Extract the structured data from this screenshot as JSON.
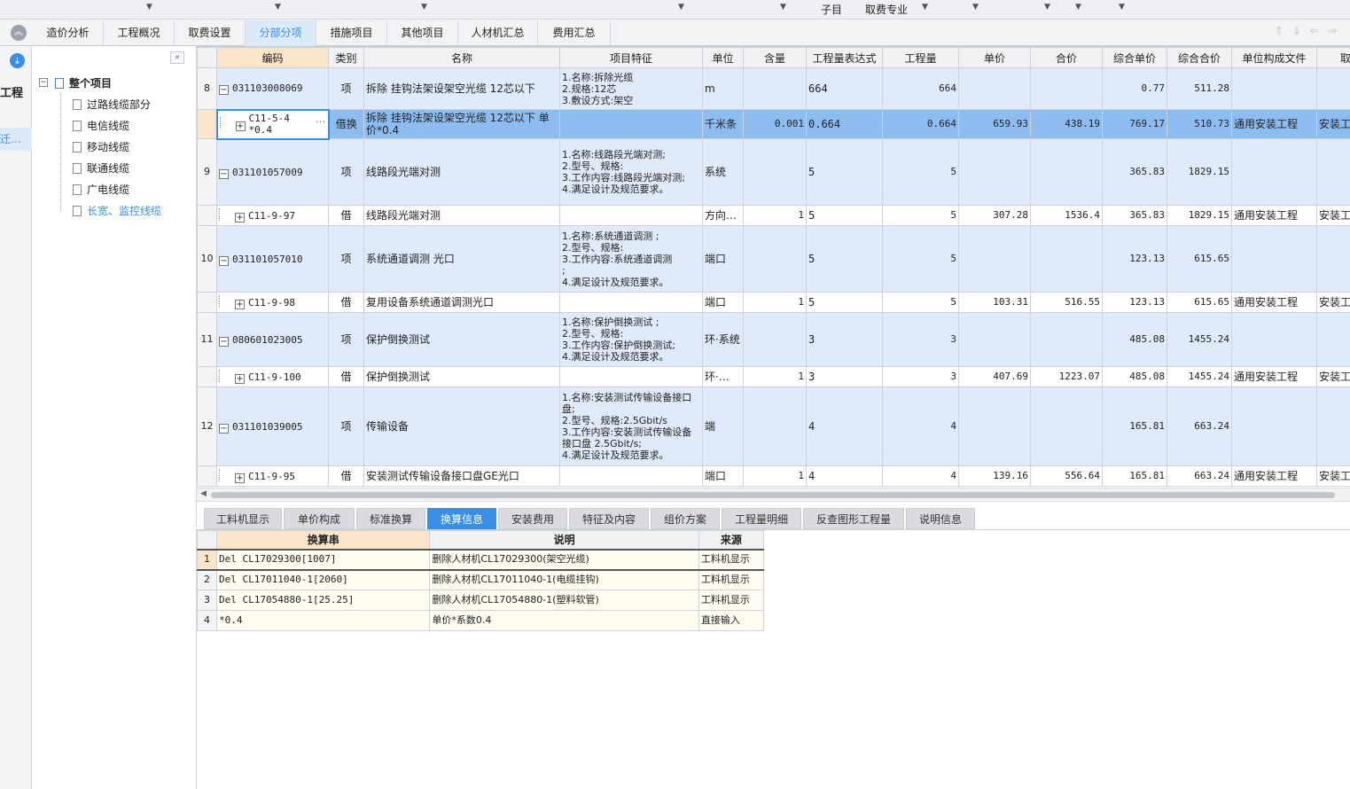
{
  "topbar": {
    "labels": [
      "子目",
      "取费专业"
    ]
  },
  "main_tabs": [
    {
      "label": "造价分析"
    },
    {
      "label": "工程概况"
    },
    {
      "label": "取费设置"
    },
    {
      "label": "分部分项"
    },
    {
      "label": "措施项目"
    },
    {
      "label": "其他项目"
    },
    {
      "label": "人材机汇总"
    },
    {
      "label": "费用汇总"
    }
  ],
  "active_main_tab": "分部分项",
  "rail": {
    "title": "工程",
    "selected": "迁..."
  },
  "tree": {
    "root": "整个项目",
    "children": [
      "过路线缆部分",
      "电信线缆",
      "移动线缆",
      "联通线缆",
      "广电线缆",
      "长宽、监控线缆"
    ],
    "selected": "长宽、监控线缆"
  },
  "grid": {
    "headers": [
      "编码",
      "类别",
      "名称",
      "项目特征",
      "单位",
      "含量",
      "工程量表达式",
      "工程量",
      "单价",
      "合价",
      "综合单价",
      "综合合价",
      "单位构成文件",
      "取费"
    ],
    "rows": [
      {
        "kind": "item",
        "rn": "8",
        "code": "031103008069",
        "type": "项",
        "name": "拆除 挂钩法架设架空光缆 12芯以下",
        "feature": "1.名称:拆除光缆\n2.规格:12芯\n3.敷设方式:架空",
        "unit": "m",
        "content": "",
        "expr": "664",
        "qty": "664",
        "price": "",
        "total": "",
        "cprice": "0.77",
        "ctotal": "511.28",
        "file": "",
        "fee": ""
      },
      {
        "kind": "sel",
        "rn": "",
        "code": "C11-5-4\n*0.4",
        "type": "借换",
        "name": "拆除 挂钩法架设架空光缆 12芯以下 单价*0.4",
        "feature": "",
        "unit": "千米条",
        "content": "0.001",
        "expr": "0.664",
        "qty": "0.664",
        "price": "659.93",
        "total": "438.19",
        "cprice": "769.17",
        "ctotal": "510.73",
        "file": "通用安装工程",
        "fee": "安装工"
      },
      {
        "kind": "item",
        "rn": "9",
        "code": "031101057009",
        "type": "项",
        "name": "线路段光端对测",
        "feature": "1.名称:线路段光端对测;\n2.型号、规格:\n3.工作内容:线路段光端对测;\n4.满足设计及规范要求。",
        "unit": "系统",
        "content": "",
        "expr": "5",
        "qty": "5",
        "price": "",
        "total": "",
        "cprice": "365.83",
        "ctotal": "1829.15",
        "file": "",
        "fee": ""
      },
      {
        "kind": "sub",
        "rn": "",
        "code": "C11-9-97",
        "type": "借",
        "name": "线路段光端对测",
        "feature": "",
        "unit": "方向…",
        "content": "1",
        "expr": "5",
        "qty": "5",
        "price": "307.28",
        "total": "1536.4",
        "cprice": "365.83",
        "ctotal": "1829.15",
        "file": "通用安装工程",
        "fee": "安装工"
      },
      {
        "kind": "item",
        "rn": "10",
        "code": "031101057010",
        "type": "项",
        "name": "系统通道调测 光口",
        "feature": "1.名称:系统通道调测 ;\n2.型号、规格:\n3.工作内容:系统通道调测\n;\n4.满足设计及规范要求。",
        "unit": "端口",
        "content": "",
        "expr": "5",
        "qty": "5",
        "price": "",
        "total": "",
        "cprice": "123.13",
        "ctotal": "615.65",
        "file": "",
        "fee": ""
      },
      {
        "kind": "sub",
        "rn": "",
        "code": "C11-9-98",
        "type": "借",
        "name": "复用设备系统通道调测光口",
        "feature": "",
        "unit": "端口",
        "content": "1",
        "expr": "5",
        "qty": "5",
        "price": "103.31",
        "total": "516.55",
        "cprice": "123.13",
        "ctotal": "615.65",
        "file": "通用安装工程",
        "fee": "安装工"
      },
      {
        "kind": "item",
        "rn": "11",
        "code": "080601023005",
        "type": "项",
        "name": "保护倒换测试",
        "feature": "1.名称:保护倒换测试 ;\n2.型号、规格:\n3.工作内容:保护倒换测试;\n4.满足设计及规范要求。",
        "unit": "环·系统",
        "content": "",
        "expr": "3",
        "qty": "3",
        "price": "",
        "total": "",
        "cprice": "485.08",
        "ctotal": "1455.24",
        "file": "",
        "fee": ""
      },
      {
        "kind": "sub",
        "rn": "",
        "code": "C11-9-100",
        "type": "借",
        "name": "保护倒换测试",
        "feature": "",
        "unit": "环·…",
        "content": "1",
        "expr": "3",
        "qty": "3",
        "price": "407.69",
        "total": "1223.07",
        "cprice": "485.08",
        "ctotal": "1455.24",
        "file": "通用安装工程",
        "fee": "安装工"
      },
      {
        "kind": "item",
        "rn": "12",
        "code": "031101039005",
        "type": "项",
        "name": "传输设备",
        "feature": "1.名称:安装测试传输设备接口盘;\n2.型号、规格:2.5Gbit/s\n3.工作内容:安装测试传输设备接口盘 2.5Gbit/s;\n4.满足设计及规范要求。",
        "unit": "端",
        "content": "",
        "expr": "4",
        "qty": "4",
        "price": "",
        "total": "",
        "cprice": "165.81",
        "ctotal": "663.24",
        "file": "",
        "fee": ""
      },
      {
        "kind": "sub",
        "rn": "",
        "code": "C11-9-95",
        "type": "借",
        "name": "安装测试传输设备接口盘GE光口",
        "feature": "",
        "unit": "端口",
        "content": "1",
        "expr": "4",
        "qty": "4",
        "price": "139.16",
        "total": "556.64",
        "cprice": "165.81",
        "ctotal": "663.24",
        "file": "通用安装工程",
        "fee": "安装工"
      }
    ]
  },
  "bottom_tabs": [
    {
      "label": "工料机显示"
    },
    {
      "label": "单价构成"
    },
    {
      "label": "标准换算"
    },
    {
      "label": "换算信息"
    },
    {
      "label": "安装费用"
    },
    {
      "label": "特征及内容"
    },
    {
      "label": "组价方案"
    },
    {
      "label": "工程量明细"
    },
    {
      "label": "反查图形工程量"
    },
    {
      "label": "说明信息"
    }
  ],
  "active_bottom_tab": "换算信息",
  "bottom_grid": {
    "headers": [
      "换算串",
      "说明",
      "来源"
    ],
    "rows": [
      {
        "rn": "1",
        "expr": "Del CL17029300[1007]",
        "desc": "删除人材机CL17029300(架空光缆)",
        "src": "工料机显示"
      },
      {
        "rn": "2",
        "expr": "Del CL17011040-1[2060]",
        "desc": "删除人材机CL17011040-1(电缆挂钩)",
        "src": "工料机显示"
      },
      {
        "rn": "3",
        "expr": "Del CL17054880-1[25.25]",
        "desc": "删除人材机CL17054880-1(塑料软管)",
        "src": "工料机显示"
      },
      {
        "rn": "4",
        "expr": "*0.4",
        "desc": "单价*系数0.4",
        "src": "直接输入"
      }
    ]
  },
  "colors": {
    "accent": "#3a8ee6",
    "item_row": "#dfeafa",
    "selected_row": "#8dbdf0",
    "header_highlight": "#fbe5c9"
  }
}
